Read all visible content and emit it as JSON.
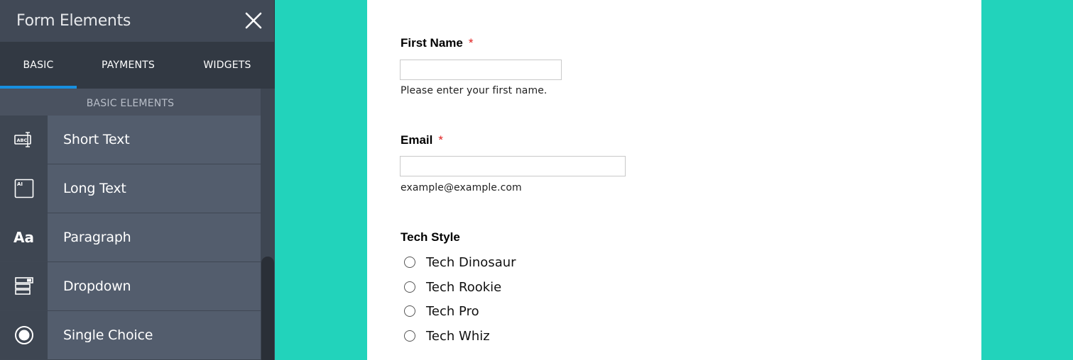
{
  "panel": {
    "title": "Form Elements",
    "close_icon": "close-icon",
    "tabs": [
      {
        "label": "BASIC",
        "active": true
      },
      {
        "label": "PAYMENTS",
        "active": false
      },
      {
        "label": "WIDGETS",
        "active": false
      }
    ],
    "section_title": "BASIC ELEMENTS",
    "items": [
      {
        "label": "Short Text",
        "icon": "short-text-icon"
      },
      {
        "label": "Long Text",
        "icon": "long-text-icon"
      },
      {
        "label": "Paragraph",
        "icon": "paragraph-icon"
      },
      {
        "label": "Dropdown",
        "icon": "dropdown-icon"
      },
      {
        "label": "Single Choice",
        "icon": "single-choice-icon"
      }
    ]
  },
  "form": {
    "first_name": {
      "label": "First Name",
      "required_mark": "*",
      "value": "",
      "sublabel": "Please enter your first name."
    },
    "email": {
      "label": "Email",
      "required_mark": "*",
      "value": "",
      "sublabel": "example@example.com"
    },
    "tech_style": {
      "label": "Tech Style",
      "options": [
        "Tech Dinosaur",
        "Tech Rookie",
        "Tech Pro",
        "Tech Whiz"
      ]
    }
  },
  "colors": {
    "background": "#22d3bb",
    "panel": "#3e4652",
    "tab_active_underline": "#1790e0",
    "required": "#e02020"
  }
}
